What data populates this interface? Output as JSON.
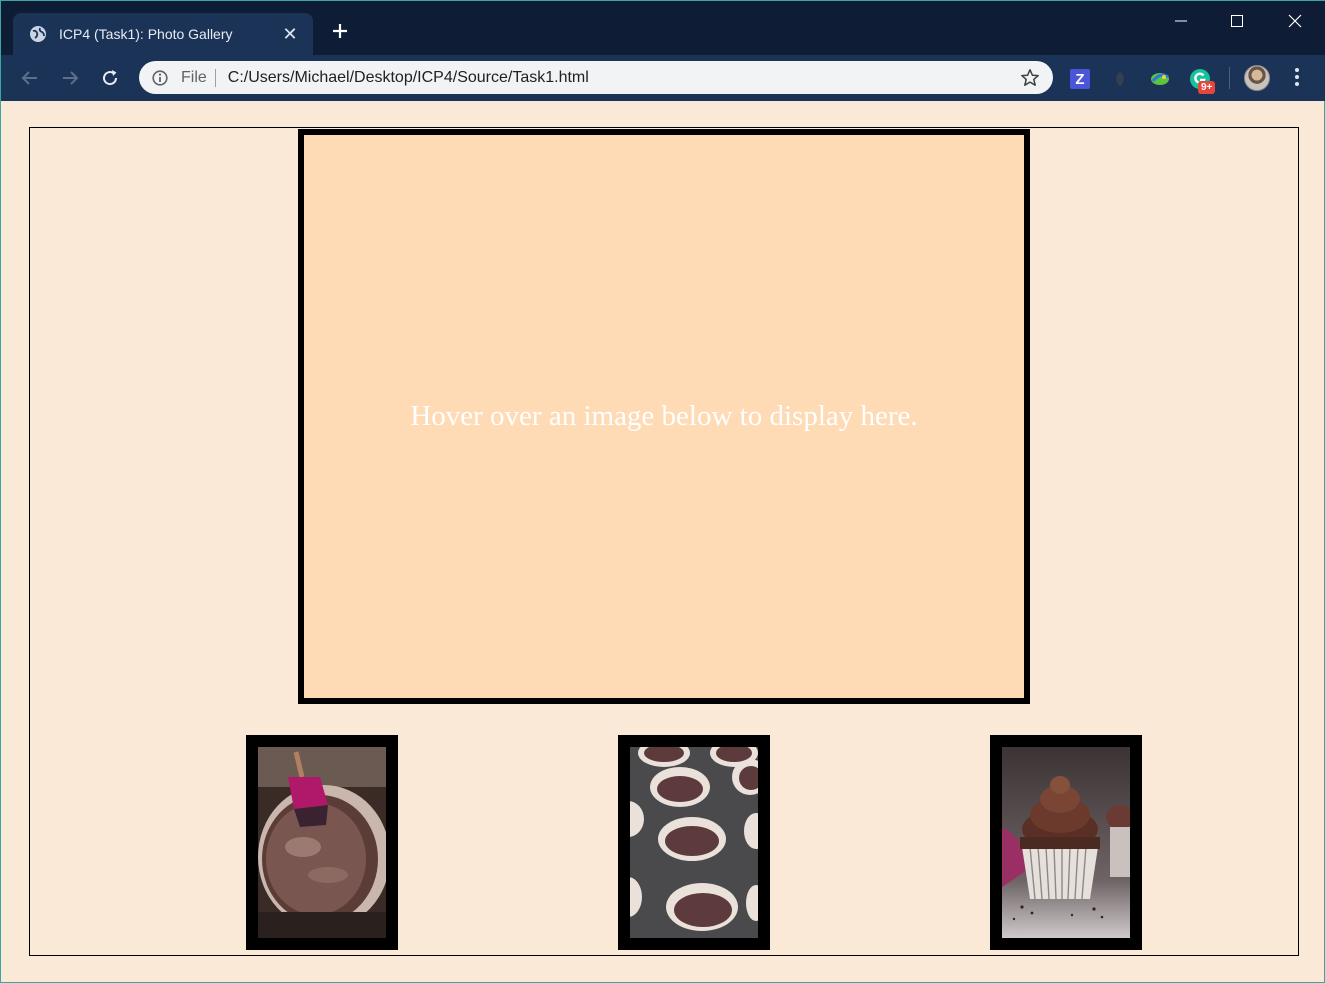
{
  "browser": {
    "tab_title": "ICP4 (Task1): Photo Gallery",
    "omnibox": {
      "scheme": "File",
      "url": "C:/Users/Michael/Desktop/ICP4/Source/Task1.html"
    },
    "extension_badge": "9+",
    "icons": [
      "globe-icon",
      "close-icon",
      "plus-icon",
      "minimize-icon",
      "maximize-icon",
      "window-close-icon",
      "back-arrow-icon",
      "forward-arrow-icon",
      "reload-icon",
      "info-icon",
      "star-icon",
      "z-extension-icon",
      "leaf-extension-icon",
      "chameleon-extension-icon",
      "grammarly-extension-icon",
      "menu-icon"
    ]
  },
  "page": {
    "display_text": "Hover over an image below to display here.",
    "colors": {
      "page_background": "#fbe9d7",
      "display_background": "#fedab5",
      "frame": "#000000",
      "display_text": "#ffffff"
    },
    "thumbnails": [
      {
        "subject": "chocolate batter in glass bowl with pink spatula"
      },
      {
        "subject": "cupcake liners with batter in muffin tin"
      },
      {
        "subject": "chocolate frosted cupcake"
      }
    ]
  }
}
